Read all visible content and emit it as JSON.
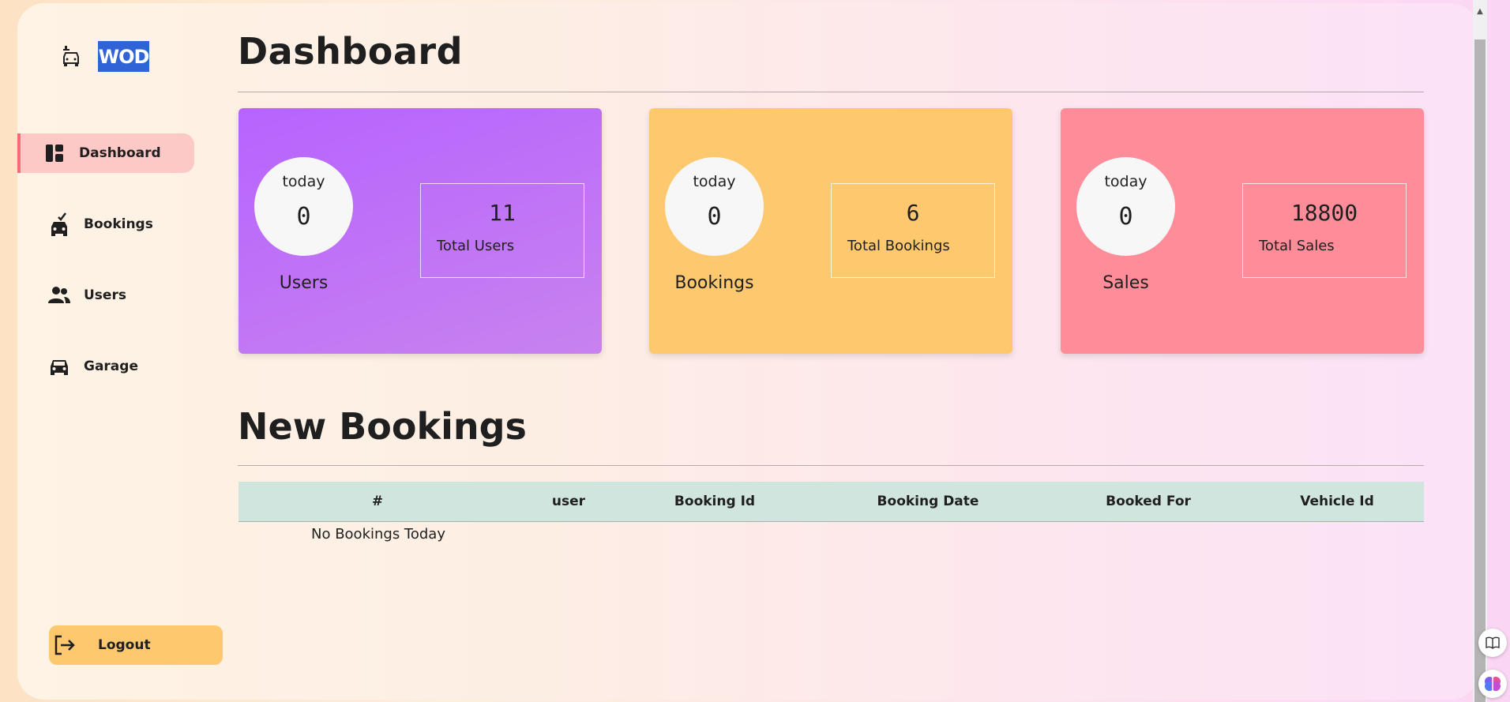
{
  "brand": {
    "logo_text": "WOD",
    "logo_icon": "car-service-icon"
  },
  "sidebar": {
    "items": [
      {
        "label": "Dashboard",
        "icon": "dashboard-icon",
        "active": true
      },
      {
        "label": "Bookings",
        "icon": "car-booking-icon",
        "active": false
      },
      {
        "label": "Users",
        "icon": "users-icon",
        "active": false
      },
      {
        "label": "Garage",
        "icon": "car-icon",
        "active": false
      }
    ],
    "logout_label": "Logout",
    "logout_icon": "logout-icon"
  },
  "main": {
    "title": "Dashboard",
    "cards": [
      {
        "name": "Users",
        "today_label": "today",
        "today_value": "0",
        "total_value": "11",
        "total_label": "Total Users",
        "color": "#b763ff"
      },
      {
        "name": "Bookings",
        "today_label": "today",
        "today_value": "0",
        "total_value": "6",
        "total_label": "Total Bookings",
        "color": "#fec96e"
      },
      {
        "name": "Sales",
        "today_label": "today",
        "today_value": "0",
        "total_value": "18800",
        "total_label": "Total Sales",
        "color": "#ff8d99"
      }
    ],
    "new_bookings": {
      "title": "New Bookings",
      "columns": [
        "#",
        "user",
        "Booking Id",
        "Booking Date",
        "Booked For",
        "Vehicle Id"
      ],
      "empty_message": "No Bookings Today"
    }
  },
  "colors": {
    "header_row": "#d0e5dd",
    "active_nav": "#fcc9c7",
    "logout_bg": "#fec96e",
    "logo_bg": "#2f63d6"
  }
}
